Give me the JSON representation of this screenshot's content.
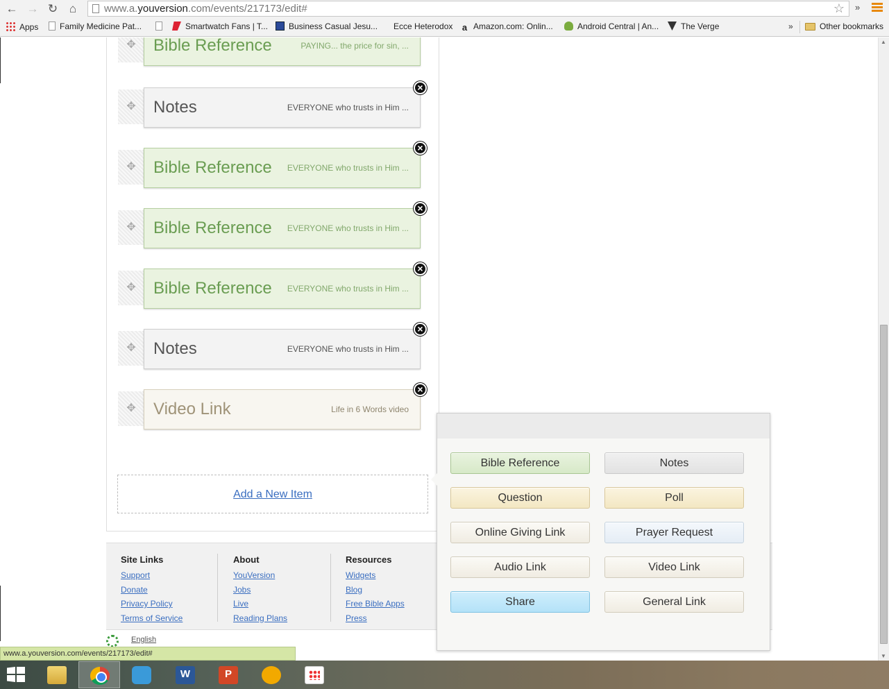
{
  "browser": {
    "url_prefix": "www.a.",
    "url_domain": "youversion",
    "url_suffix": ".com/events/217173/edit#",
    "extensions_more": "»",
    "bookmarks": [
      {
        "label": "Apps",
        "icon": "apps-grid-icon"
      },
      {
        "label": "Family Medicine Pat...",
        "icon": "page-icon"
      },
      {
        "label": "Smartwatch Fans | T...",
        "icon": "smartwatch-icon"
      },
      {
        "label": "Business Casual Jesu...",
        "icon": "blog-icon"
      },
      {
        "label": "Ecce Heterodox",
        "icon": ""
      },
      {
        "label": "Amazon.com: Onlin...",
        "icon": "amazon-icon"
      },
      {
        "label": "Android Central | An...",
        "icon": "android-icon"
      },
      {
        "label": "The Verge",
        "icon": "verge-icon"
      }
    ],
    "bookmarks_more": "»",
    "other_bookmarks": "Other bookmarks"
  },
  "items": [
    {
      "type": "bible",
      "title": "Bible Reference",
      "desc": "PAYING... the price for sin, ..."
    },
    {
      "type": "notes",
      "title": "Notes",
      "desc": "EVERYONE who trusts in Him ..."
    },
    {
      "type": "bible",
      "title": "Bible Reference",
      "desc": "EVERYONE who trusts in Him ..."
    },
    {
      "type": "bible",
      "title": "Bible Reference",
      "desc": "EVERYONE who trusts in Him ..."
    },
    {
      "type": "bible",
      "title": "Bible Reference",
      "desc": "EVERYONE who trusts in Him ..."
    },
    {
      "type": "notes",
      "title": "Notes",
      "desc": "EVERYONE who trusts in Him ..."
    },
    {
      "type": "video",
      "title": "Video Link",
      "desc": "Life in 6 Words video"
    }
  ],
  "add_new_label": "Add a New Item",
  "popup": {
    "buttons": [
      {
        "label": "Bible Reference",
        "style": "bible"
      },
      {
        "label": "Notes",
        "style": "notes"
      },
      {
        "label": "Question",
        "style": "question"
      },
      {
        "label": "Poll",
        "style": "poll"
      },
      {
        "label": "Online Giving Link",
        "style": "giving"
      },
      {
        "label": "Prayer Request",
        "style": "prayer"
      },
      {
        "label": "Audio Link",
        "style": "audio"
      },
      {
        "label": "Video Link",
        "style": "video"
      },
      {
        "label": "Share",
        "style": "share"
      },
      {
        "label": "General Link",
        "style": "general"
      }
    ]
  },
  "footer": {
    "columns": [
      {
        "heading": "Site Links",
        "links": [
          "Support",
          "Donate",
          "Privacy Policy",
          "Terms of Service"
        ]
      },
      {
        "heading": "About",
        "links": [
          "YouVersion",
          "Jobs",
          "Live",
          "Reading Plans"
        ]
      },
      {
        "heading": "Resources",
        "links": [
          "Widgets",
          "Blog",
          "Free Bible Apps",
          "Press"
        ]
      }
    ],
    "language": "English"
  },
  "status_bar": "www.a.youversion.com/events/217173/edit#",
  "colors": {
    "bible_green": "#6a9d52",
    "link_blue": "#3a6ec0",
    "share_blue": "#b4e2f8"
  }
}
